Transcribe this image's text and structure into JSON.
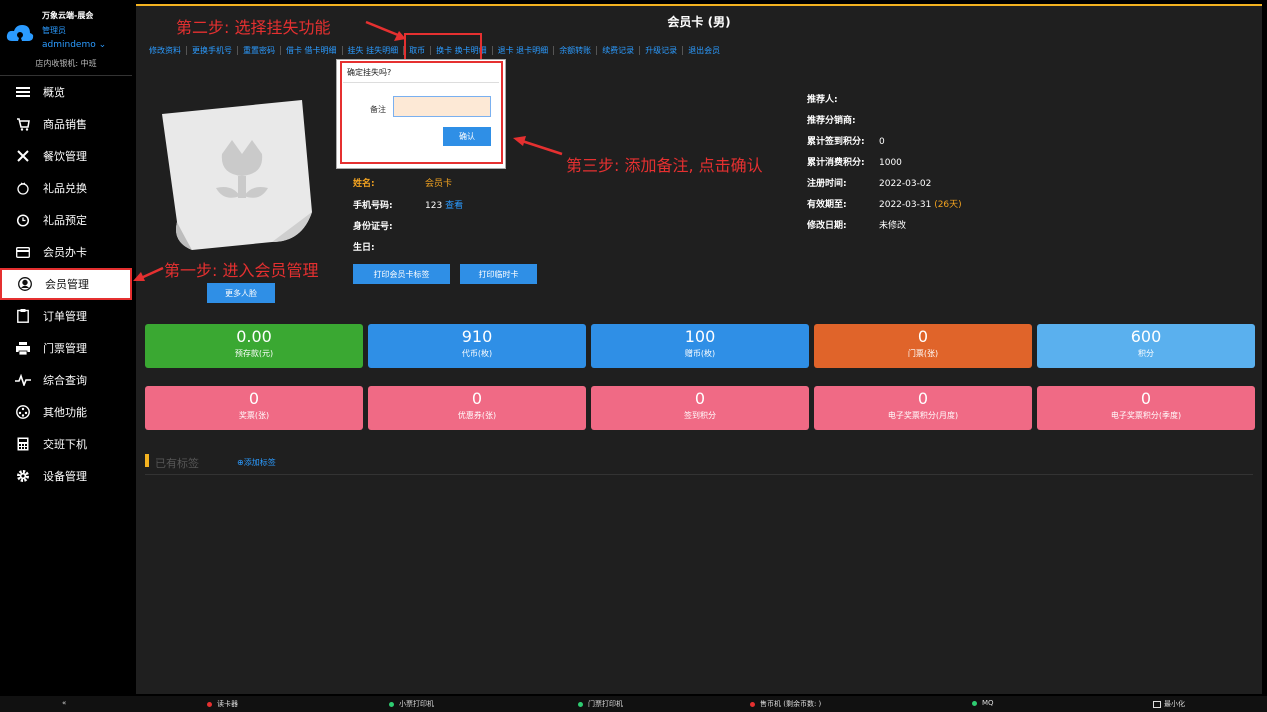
{
  "brand": {
    "title": "万象云端-展会",
    "role": "管理员",
    "user": "admindemo ⌄",
    "cashier": "店内收银机: 中班"
  },
  "sidebar": {
    "items": [
      {
        "label": "概览",
        "icon": "menu-icon"
      },
      {
        "label": "商品销售",
        "icon": "cart-icon"
      },
      {
        "label": "餐饮管理",
        "icon": "utensils-icon"
      },
      {
        "label": "礼品兑换",
        "icon": "gift-icon"
      },
      {
        "label": "礼品预定",
        "icon": "clock-icon"
      },
      {
        "label": "会员办卡",
        "icon": "card-icon"
      },
      {
        "label": "会员管理",
        "icon": "user-icon"
      },
      {
        "label": "订单管理",
        "icon": "clipboard-icon"
      },
      {
        "label": "门票管理",
        "icon": "printer-icon"
      },
      {
        "label": "综合查询",
        "icon": "pulse-icon"
      },
      {
        "label": "其他功能",
        "icon": "dial-icon"
      },
      {
        "label": "交班下机",
        "icon": "calculator-icon"
      },
      {
        "label": "设备管理",
        "icon": "gear-icon"
      }
    ]
  },
  "main": {
    "title": "会员卡 (男)",
    "tabs": [
      "修改资料",
      "更换手机号",
      "重置密码",
      "借卡 借卡明细",
      "挂失 挂失明细",
      "取币",
      "换卡 换卡明细",
      "退卡 退卡明细",
      "余额转账",
      "续费记录",
      "升级记录",
      "退出会员"
    ],
    "more_face": "更多人脸",
    "info_left": [
      {
        "label": "姓名:",
        "value": "会员卡",
        "style": "orange"
      },
      {
        "label": "手机号码:",
        "value": "123",
        "link": "查看"
      },
      {
        "label": "身份证号:",
        "value": ""
      },
      {
        "label": "生日:",
        "value": ""
      }
    ],
    "info_right": [
      {
        "label": "推荐人:",
        "value": ""
      },
      {
        "label": "推荐分销商:",
        "value": ""
      },
      {
        "label": "累计签到积分:",
        "value": "0"
      },
      {
        "label": "累计消费积分:",
        "value": "1000"
      },
      {
        "label": "注册时间:",
        "value": "2022-03-02"
      },
      {
        "label": "有效期至:",
        "value": "2022-03-31",
        "extra": "(26天)"
      },
      {
        "label": "修改日期:",
        "value": "未修改"
      }
    ],
    "print_buttons": [
      "打印会员卡标签",
      "打印临时卡"
    ],
    "stats_row1": [
      {
        "num": "0.00",
        "cap": "预存款(元)",
        "color": "#3aa832"
      },
      {
        "num": "910",
        "cap": "代币(枚)",
        "color": "#2f8fe6"
      },
      {
        "num": "100",
        "cap": "赠币(枚)",
        "color": "#2f8fe6"
      },
      {
        "num": "0",
        "cap": "门票(张)",
        "color": "#e0642a"
      },
      {
        "num": "600",
        "cap": "积分",
        "color": "#5ab0ee"
      }
    ],
    "stats_row2": [
      {
        "num": "0",
        "cap": "奖票(张)",
        "color": "#f06a85"
      },
      {
        "num": "0",
        "cap": "优惠券(张)",
        "color": "#f06a85"
      },
      {
        "num": "0",
        "cap": "签到积分",
        "color": "#f06a85"
      },
      {
        "num": "0",
        "cap": "电子奖票积分(月度)",
        "color": "#f06a85"
      },
      {
        "num": "0",
        "cap": "电子奖票积分(季度)",
        "color": "#f06a85"
      }
    ],
    "tags": {
      "title": "已有标签",
      "add": "⊕添加标签"
    }
  },
  "dialog": {
    "title": "确定挂失吗?",
    "remark_label": "备注",
    "remark_value": "",
    "ok_label": "确认"
  },
  "annotations": {
    "step1": "第一步: 进入会员管理",
    "step2": "第二步: 选择挂失功能",
    "step3": "第三步: 添加备注, 点击确认"
  },
  "statusbar": {
    "collapse": "«",
    "items": [
      {
        "label": "读卡器",
        "color": "#e53030"
      },
      {
        "label": "小票打印机",
        "color": "#2ecc71"
      },
      {
        "label": "门票打印机",
        "color": "#2ecc71"
      },
      {
        "label": "售币机 (剩余币数: )",
        "color": "#e53030"
      },
      {
        "label": "MQ",
        "color": "#2ecc71"
      }
    ],
    "minimize": "最小化"
  }
}
